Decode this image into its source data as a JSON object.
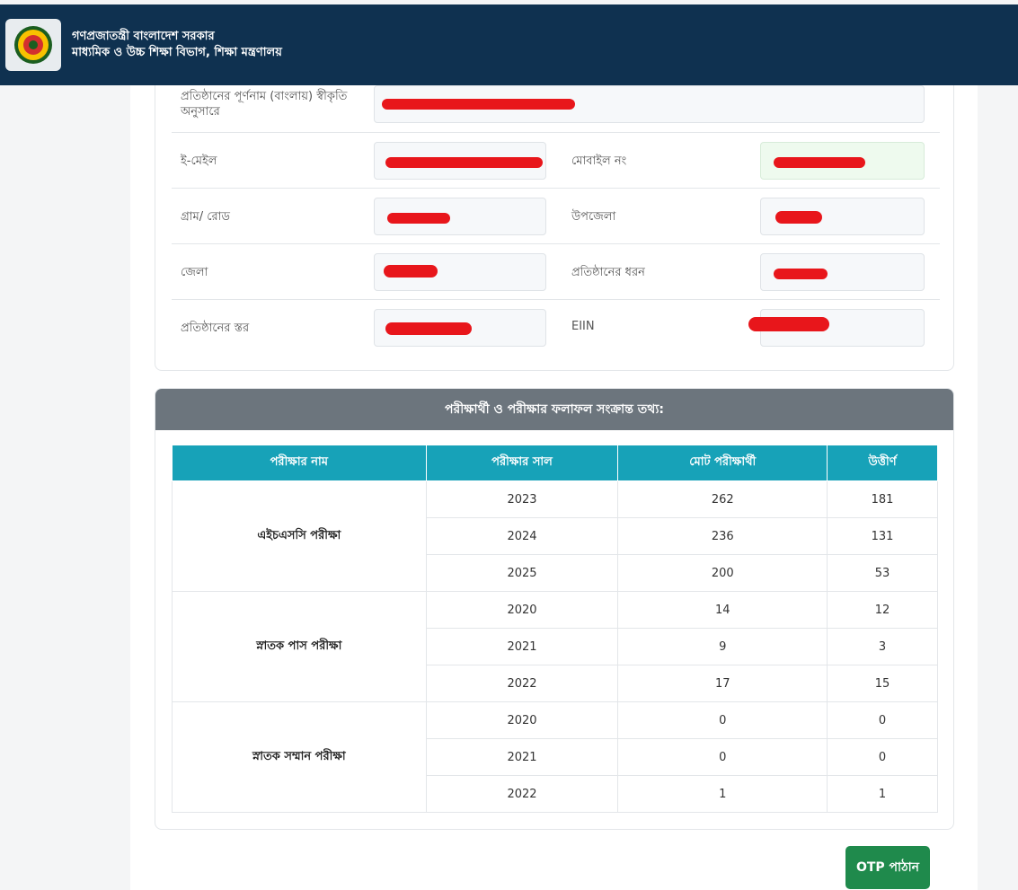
{
  "header": {
    "line1": "গণপ্রজাতন্ত্রী বাংলাদেশ সরকার",
    "line2": "মাধ্যমিক ও উচ্চ শিক্ষা বিভাগ, শিক্ষা মন্ত্রণালয়",
    "logo_icon": "bangladesh-govt-seal-icon"
  },
  "institution": {
    "full_name_label": "প্রতিষ্ঠানের পূর্ণনাম (বাংলায়) স্বীকৃতি অনুসারে",
    "email_label": "ই-মেইল",
    "mobile_label": "মোবাইল নং",
    "village_label": "গ্রাম/ রোড",
    "upazila_label": "উপজেলা",
    "district_label": "জেলা",
    "type_label": "প্রতিষ্ঠানের ধরন",
    "level_label": "প্রতিষ্ঠানের স্তর",
    "eiin_label": "EIIN"
  },
  "results": {
    "title": "পরীক্ষার্থী ও পরীক্ষার ফলাফল সংক্রান্ত তথ্য:",
    "columns": [
      "পরীক্ষার নাম",
      "পরীক্ষার সাল",
      "মোট পরীক্ষার্থী",
      "উত্তীর্ণ"
    ],
    "groups": [
      {
        "exam": "এইচএসসি পরীক্ষা",
        "rows": [
          {
            "year": "2023",
            "total": "262",
            "passed": "181"
          },
          {
            "year": "2024",
            "total": "236",
            "passed": "131"
          },
          {
            "year": "2025",
            "total": "200",
            "passed": "53"
          }
        ]
      },
      {
        "exam": "স্নাতক পাস পরীক্ষা",
        "rows": [
          {
            "year": "2020",
            "total": "14",
            "passed": "12"
          },
          {
            "year": "2021",
            "total": "9",
            "passed": "3"
          },
          {
            "year": "2022",
            "total": "17",
            "passed": "15"
          }
        ]
      },
      {
        "exam": "স্নাতক সম্মান পরীক্ষা",
        "rows": [
          {
            "year": "2020",
            "total": "0",
            "passed": "0"
          },
          {
            "year": "2021",
            "total": "0",
            "passed": "0"
          },
          {
            "year": "2022",
            "total": "1",
            "passed": "1"
          }
        ]
      }
    ]
  },
  "actions": {
    "otp_button": "OTP পাঠান"
  },
  "colors": {
    "header_bg": "#0f3150",
    "table_header": "#17a2b8",
    "section_header": "#6c757d",
    "button_green": "#1f8a4c",
    "redaction": "#e8161b"
  }
}
